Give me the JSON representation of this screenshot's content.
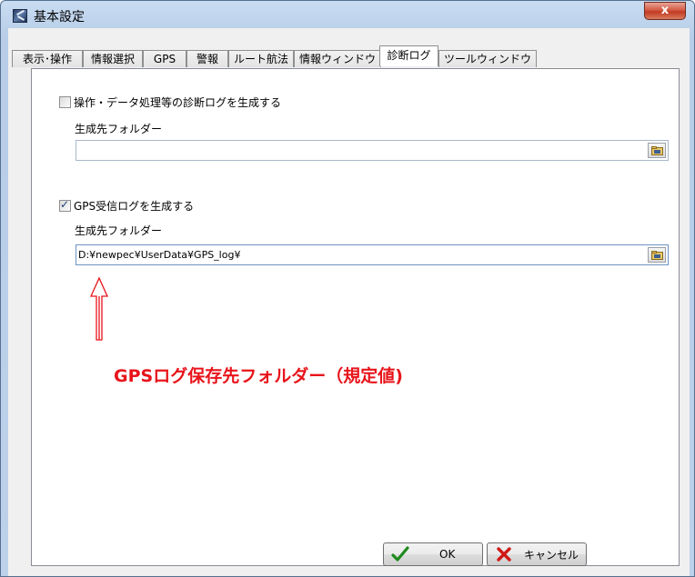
{
  "window": {
    "title": "基本設定",
    "close_label": "x"
  },
  "tabs": [
    {
      "label": "表示･操作",
      "active": false
    },
    {
      "label": "情報選択",
      "active": false
    },
    {
      "label": "GPS",
      "active": false
    },
    {
      "label": "警報",
      "active": false
    },
    {
      "label": "ルート航法",
      "active": false
    },
    {
      "label": "情報ウィンドウ",
      "active": false
    },
    {
      "label": "診断ログ",
      "active": true
    },
    {
      "label": "ツールウィンドウ",
      "active": false
    }
  ],
  "operation_log": {
    "checkbox_label": "操作・データ処理等の診断ログを生成する",
    "checked": false,
    "folder_label": "生成先フォルダー",
    "folder_value": ""
  },
  "gps_log": {
    "checkbox_label": "GPS受信ログを生成する",
    "checked": true,
    "folder_label": "生成先フォルダー",
    "folder_value": "D:¥newpec¥UserData¥GPS_log¥"
  },
  "annotation": {
    "text": "GPSログ保存先フォルダー（規定値)",
    "color": "#e8141b"
  },
  "buttons": {
    "ok_label": "OK",
    "cancel_label": "キャンセル"
  },
  "icons": {
    "app": "app-icon",
    "browse": "folder-icon",
    "ok": "checkmark-icon",
    "cancel": "cross-icon"
  }
}
